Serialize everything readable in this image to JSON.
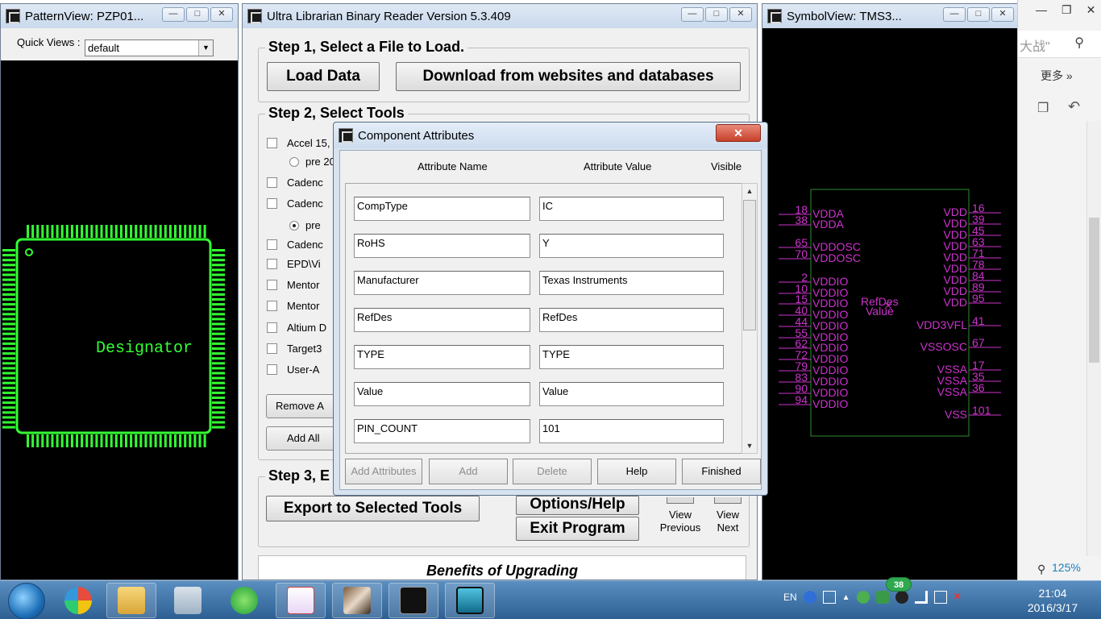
{
  "pattern_view": {
    "title": "PatternView: PZP01...",
    "quick_views_label": "Quick Views :",
    "quick_views_value": "default",
    "designator": "Designator"
  },
  "main_window": {
    "title": "Ultra Librarian Binary Reader Version 5.3.409",
    "step1_title": "Step 1, Select a File to Load.",
    "load_data": "Load Data",
    "download": "Download from websites and databases",
    "step2_title": "Step 2, Select Tools",
    "tools": [
      "Accel 15,",
      "Cadenc",
      "Cadenc",
      "Cadenc",
      "EPD\\Vi",
      "Mentor",
      "Mentor",
      "Altium D",
      "Target3",
      "User-A"
    ],
    "radio1": "pre 20",
    "radio2": "pre",
    "remove_btn": "Remove A",
    "add_all_btn": "Add All",
    "step3_title": "Step 3, E",
    "export_btn": "Export to Selected Tools",
    "options_btn": "Options/Help",
    "exit_btn": "Exit Program",
    "view_previous": "View Previous",
    "view_next": "View Next",
    "benefits": "Benefits of Upgrading"
  },
  "symbol_view": {
    "title": "SymbolView: TMS3...",
    "refdes": "RefDes",
    "value": "Value",
    "left_pins": [
      {
        "num": "18",
        "name": "VDDA"
      },
      {
        "num": "38",
        "name": "VDDA"
      },
      {
        "num": "65",
        "name": "VDDOSC"
      },
      {
        "num": "70",
        "name": "VDDOSC"
      },
      {
        "num": "2",
        "name": "VDDIO"
      },
      {
        "num": "10",
        "name": "VDDIO"
      },
      {
        "num": "15",
        "name": "VDDIO"
      },
      {
        "num": "40",
        "name": "VDDIO"
      },
      {
        "num": "44",
        "name": "VDDIO"
      },
      {
        "num": "55",
        "name": "VDDIO"
      },
      {
        "num": "62",
        "name": "VDDIO"
      },
      {
        "num": "72",
        "name": "VDDIO"
      },
      {
        "num": "79",
        "name": "VDDIO"
      },
      {
        "num": "83",
        "name": "VDDIO"
      },
      {
        "num": "90",
        "name": "VDDIO"
      },
      {
        "num": "94",
        "name": "VDDIO"
      }
    ],
    "right_pins": [
      {
        "num": "16",
        "name": "VDD"
      },
      {
        "num": "39",
        "name": "VDD"
      },
      {
        "num": "45",
        "name": "VDD"
      },
      {
        "num": "63",
        "name": "VDD"
      },
      {
        "num": "71",
        "name": "VDD"
      },
      {
        "num": "78",
        "name": "VDD"
      },
      {
        "num": "84",
        "name": "VDD"
      },
      {
        "num": "89",
        "name": "VDD"
      },
      {
        "num": "95",
        "name": "VDD"
      },
      {
        "num": "41",
        "name": "VDD3VFL"
      },
      {
        "num": "67",
        "name": "VSSOSC"
      },
      {
        "num": "17",
        "name": "VSSA"
      },
      {
        "num": "35",
        "name": "VSSA"
      },
      {
        "num": "36",
        "name": "VSSA"
      },
      {
        "num": "101",
        "name": "VSS"
      }
    ]
  },
  "browser": {
    "search_text": "大战\"",
    "more": "更多 »",
    "zoom": "125%"
  },
  "dialog": {
    "title": "Component Attributes",
    "close": "✕",
    "col_name": "Attribute Name",
    "col_value": "Attribute Value",
    "col_visible": "Visible",
    "rows": [
      {
        "name": "CompType",
        "value": "IC"
      },
      {
        "name": "RoHS",
        "value": "Y"
      },
      {
        "name": "Manufacturer",
        "value": "Texas Instruments"
      },
      {
        "name": "RefDes",
        "value": "RefDes"
      },
      {
        "name": "TYPE",
        "value": "TYPE"
      },
      {
        "name": "Value",
        "value": "Value"
      },
      {
        "name": "PIN_COUNT",
        "value": "101"
      }
    ],
    "buttons": {
      "add_attributes": "Add Attributes",
      "add": "Add",
      "delete": "Delete",
      "help": "Help",
      "finished": "Finished"
    }
  },
  "taskbar": {
    "lang": "EN",
    "time": "21:04",
    "date": "2016/3/17",
    "badge": "38"
  },
  "colors": {
    "pcb_green": "#33ff33",
    "symbol_magenta": "#cc33cc",
    "symbol_green": "#2e8b2e",
    "dialog_close_red": "#c7402a"
  }
}
